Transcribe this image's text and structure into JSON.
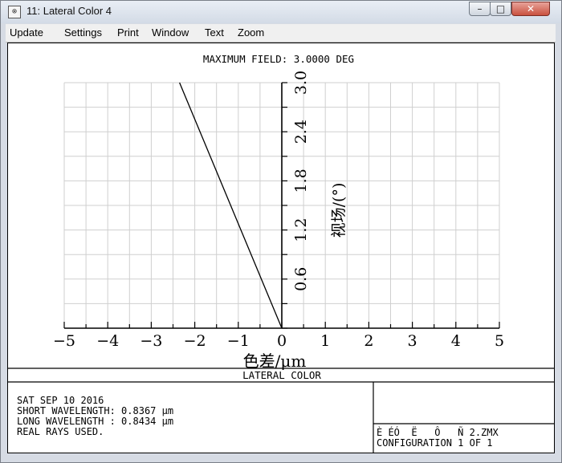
{
  "window": {
    "title": "11: Lateral Color 4",
    "icon": "zemax-app-icon",
    "controls": {
      "minimize": "–",
      "maximize": "□",
      "close": "✕"
    }
  },
  "menu": {
    "items": [
      "Update",
      "Settings",
      "Print",
      "Window",
      "Text",
      "Zoom"
    ]
  },
  "plot": {
    "header": "MAXIMUM FIELD: 3.0000 DEG",
    "section_title": "LATERAL COLOR"
  },
  "chart_data": {
    "type": "line",
    "title": "MAXIMUM FIELD: 3.0000 DEG",
    "xlabel": "色差/μm",
    "ylabel": "视场/(°)",
    "xlim": [
      -5,
      5
    ],
    "ylim": [
      0,
      3.0
    ],
    "x_ticks": [
      "−5",
      "−4",
      "−3",
      "−2",
      "−1",
      "0",
      "1",
      "2",
      "3",
      "4",
      "5"
    ],
    "y_ticks": [
      "0.6",
      "1.2",
      "1.8",
      "2.4",
      "3.0"
    ],
    "grid": true,
    "series": [
      {
        "x": [
          0,
          -2.35
        ],
        "y": [
          0,
          3.0
        ]
      }
    ]
  },
  "info": {
    "lines": [
      "SAT SEP 10 2016",
      "SHORT WAVELENGTH: 0.8367 μm",
      "LONG WAVELENGTH : 0.8434 μm",
      "REAL RAYS USED."
    ],
    "file_line": "È ÉÓ  Ë   Ô   Ñ 2.ZMX",
    "config_line": "CONFIGURATION 1 OF 1"
  }
}
